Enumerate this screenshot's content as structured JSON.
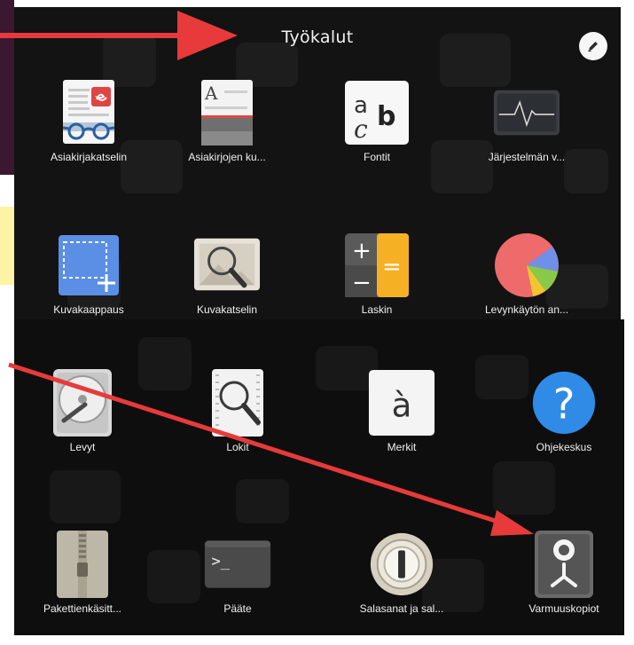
{
  "folder": {
    "title": "Työkalut",
    "edit_icon": "edit-pencil-icon"
  },
  "apps": [
    {
      "name": "Asiakirjakatselin",
      "icon": "document-viewer-icon"
    },
    {
      "name": "Asiakirjojen ku...",
      "icon": "document-scanner-icon"
    },
    {
      "name": "Fontit",
      "icon": "fonts-icon"
    },
    {
      "name": "Järjestelmän v...",
      "icon": "system-monitor-icon"
    },
    {
      "name": "Kuvakaappaus",
      "icon": "screenshot-icon"
    },
    {
      "name": "Kuvakatselin",
      "icon": "image-viewer-icon"
    },
    {
      "name": "Laskin",
      "icon": "calculator-icon"
    },
    {
      "name": "Levynkäytön an...",
      "icon": "disk-usage-analyzer-icon"
    },
    {
      "name": "Levyt",
      "icon": "disks-icon"
    },
    {
      "name": "Lokit",
      "icon": "logs-icon"
    },
    {
      "name": "Merkit",
      "icon": "characters-icon"
    },
    {
      "name": "Ohjekeskus",
      "icon": "help-icon"
    },
    {
      "name": "Pakettienkäsitt...",
      "icon": "archive-manager-icon"
    },
    {
      "name": "Pääte",
      "icon": "terminal-icon"
    },
    {
      "name": "Salasanat ja sal...",
      "icon": "passwords-and-keys-icon"
    },
    {
      "name": "Varmuuskopiot",
      "icon": "backups-icon"
    }
  ],
  "glyphs": {
    "fonts_small_a": "a",
    "fonts_small_c": "c",
    "fonts_bold_b": "b",
    "viewer_letter": "A",
    "characters_glyph": "à",
    "help_glyph": "?",
    "terminal_prompt": ">_",
    "calc_plus": "+",
    "calc_minus": "−",
    "calc_equals": "="
  },
  "colors": {
    "annotation_arrow": "#e83a3a",
    "panel_background": "#131313",
    "label_text": "#f0f0f0"
  }
}
